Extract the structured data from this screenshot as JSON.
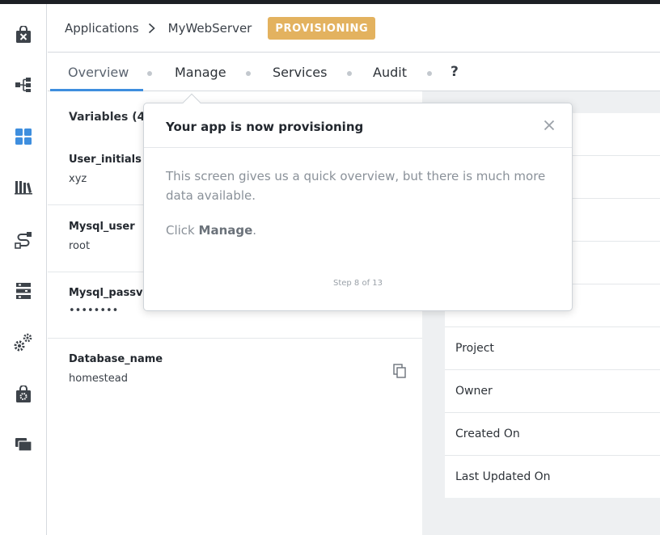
{
  "breadcrumb": {
    "root": "Applications",
    "current": "MyWebServer",
    "status": "PROVISIONING"
  },
  "tabs": [
    {
      "label": "Overview"
    },
    {
      "label": "Manage"
    },
    {
      "label": "Services"
    },
    {
      "label": "Audit"
    }
  ],
  "help_label": "?",
  "variables": {
    "title": "Variables (4",
    "items": [
      {
        "name": "User_initials",
        "value": "xyz"
      },
      {
        "name": "Mysql_user",
        "value": "root"
      },
      {
        "name": "Mysql_passv",
        "value": "••••••••"
      },
      {
        "name": "Database_name",
        "value": "homestead"
      }
    ]
  },
  "details": {
    "rows": [
      {
        "label": ""
      },
      {
        "label": ""
      },
      {
        "label": ""
      },
      {
        "label": ""
      },
      {
        "label": ""
      },
      {
        "label": "Project"
      },
      {
        "label": "Owner"
      },
      {
        "label": "Created On"
      },
      {
        "label": "Last Updated On"
      }
    ]
  },
  "popover": {
    "title": "Your app is now provisioning",
    "body": "This screen gives us a quick overview, but there is much more data available.",
    "click_prefix": "Click ",
    "click_target": "Manage",
    "click_suffix": ".",
    "step": "Step 8 of 13"
  },
  "sidebar": {
    "icons": [
      "app-store-icon",
      "blueprint-icon",
      "applications-icon",
      "library-icon",
      "runbooks-icon",
      "endpoints-icon",
      "settings-icon",
      "marketplace-icon",
      "folders-icon"
    ],
    "active": "applications-icon"
  },
  "colors": {
    "accent": "#3e8ede",
    "badge": "#e3b25f",
    "sidebar_active": "#3e8ede",
    "icon": "#3d434a"
  }
}
